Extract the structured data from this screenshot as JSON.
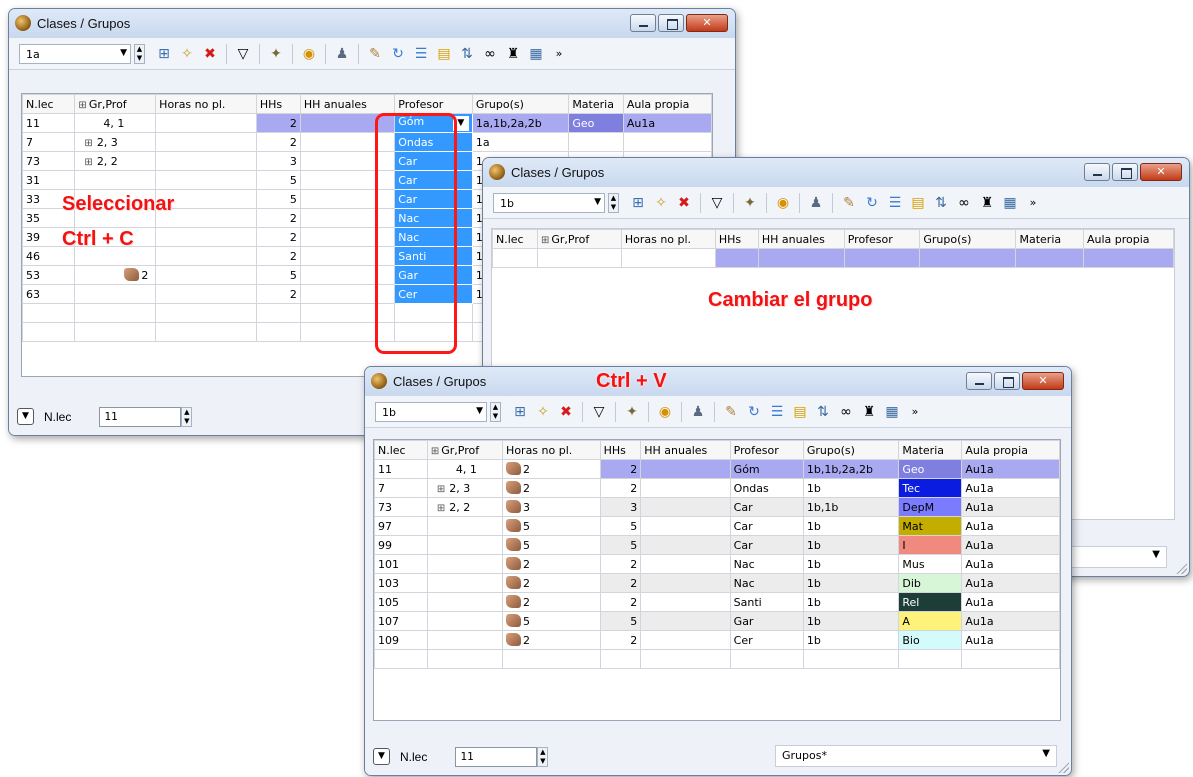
{
  "window1": {
    "title": "Clases / Grupos",
    "class_value": "1a",
    "columns": [
      "N.lec",
      "Gr,Prof",
      "Horas no pl.",
      "HHs",
      "HH anuales",
      "Profesor",
      "Grupo(s)",
      "Materia",
      "Aula propia"
    ],
    "rows": [
      {
        "nlec": "11",
        "gr": "4, 1",
        "gr_expand": false,
        "horas": "",
        "horas_icon": false,
        "hhs": "2",
        "prof": "Góm",
        "grupos": "1a,1b,2a,2b",
        "materia": "Geo",
        "aula": "Au1a"
      },
      {
        "nlec": "7",
        "gr": "2, 3",
        "gr_expand": true,
        "horas": "",
        "horas_icon": false,
        "hhs": "2",
        "prof": "Ondas",
        "grupos": "1a",
        "materia": "",
        "aula": ""
      },
      {
        "nlec": "73",
        "gr": "2, 2",
        "gr_expand": true,
        "horas": "",
        "horas_icon": false,
        "hhs": "3",
        "prof": "Car",
        "grupos": "1a,",
        "materia": "",
        "aula": ""
      },
      {
        "nlec": "31",
        "gr": "",
        "gr_expand": false,
        "horas": "",
        "horas_icon": false,
        "hhs": "5",
        "prof": "Car",
        "grupos": "1a",
        "materia": "",
        "aula": ""
      },
      {
        "nlec": "33",
        "gr": "",
        "gr_expand": false,
        "horas": "",
        "horas_icon": false,
        "hhs": "5",
        "prof": "Car",
        "grupos": "1a",
        "materia": "",
        "aula": ""
      },
      {
        "nlec": "35",
        "gr": "",
        "gr_expand": false,
        "horas": "",
        "horas_icon": false,
        "hhs": "2",
        "prof": "Nac",
        "grupos": "1a",
        "materia": "",
        "aula": ""
      },
      {
        "nlec": "39",
        "gr": "",
        "gr_expand": false,
        "horas": "",
        "horas_icon": false,
        "hhs": "2",
        "prof": "Nac",
        "grupos": "1a",
        "materia": "",
        "aula": ""
      },
      {
        "nlec": "46",
        "gr": "",
        "gr_expand": false,
        "horas": "",
        "horas_icon": false,
        "hhs": "2",
        "prof": "Santi",
        "grupos": "1a",
        "materia": "",
        "aula": ""
      },
      {
        "nlec": "53",
        "gr": "2",
        "gr_expand": false,
        "gr_icon": true,
        "horas": "",
        "horas_icon": false,
        "hhs": "5",
        "prof": "Gar",
        "grupos": "1a",
        "materia": "",
        "aula": ""
      },
      {
        "nlec": "63",
        "gr": "",
        "gr_expand": false,
        "horas": "",
        "horas_icon": false,
        "hhs": "2",
        "prof": "Cer",
        "grupos": "1a",
        "materia": "",
        "aula": ""
      }
    ],
    "footer_label": "N.lec",
    "footer_value": "11"
  },
  "window2": {
    "title": "Clases / Grupos",
    "class_value": "1b",
    "columns": [
      "N.lec",
      "Gr,Prof",
      "Horas no pl.",
      "HHs",
      "HH anuales",
      "Profesor",
      "Grupo(s)",
      "Materia",
      "Aula propia"
    ]
  },
  "window3": {
    "title": "Clases / Grupos",
    "class_value": "1b",
    "columns": [
      "N.lec",
      "Gr,Prof",
      "Horas no pl.",
      "HHs",
      "HH anuales",
      "Profesor",
      "Grupo(s)",
      "Materia",
      "Aula propia"
    ],
    "rows": [
      {
        "nlec": "11",
        "gr": "4, 1",
        "gr_expand": false,
        "horas": "2",
        "hhs": "2",
        "prof": "Góm",
        "grupos": "1b,1b,2a,2b",
        "materia": "Geo",
        "mat_bg": "#7f7fe0",
        "mat_fg": "#ffffff",
        "aula": "Au1a"
      },
      {
        "nlec": "7",
        "gr": "2, 3",
        "gr_expand": true,
        "horas": "2",
        "hhs": "2",
        "prof": "Ondas",
        "grupos": "1b",
        "materia": "Tec",
        "mat_bg": "#0a1ce0",
        "mat_fg": "#ffffff",
        "aula": "Au1a"
      },
      {
        "nlec": "73",
        "gr": "2, 2",
        "gr_expand": true,
        "horas": "3",
        "hhs": "3",
        "prof": "Car",
        "grupos": "1b,1b",
        "materia": "DepM",
        "mat_bg": "#7b7bff",
        "mat_fg": "#000000",
        "aula": "Au1a"
      },
      {
        "nlec": "97",
        "gr": "",
        "gr_expand": false,
        "horas": "5",
        "hhs": "5",
        "prof": "Car",
        "grupos": "1b",
        "materia": "Mat",
        "mat_bg": "#c3ae00",
        "mat_fg": "#000000",
        "aula": "Au1a"
      },
      {
        "nlec": "99",
        "gr": "",
        "gr_expand": false,
        "horas": "5",
        "hhs": "5",
        "prof": "Car",
        "grupos": "1b",
        "materia": "I",
        "mat_bg": "#f08a7e",
        "mat_fg": "#000000",
        "aula": "Au1a"
      },
      {
        "nlec": "101",
        "gr": "",
        "gr_expand": false,
        "horas": "2",
        "hhs": "2",
        "prof": "Nac",
        "grupos": "1b",
        "materia": "Mus",
        "mat_bg": "#ffffff",
        "mat_fg": "#000000",
        "aula": "Au1a"
      },
      {
        "nlec": "103",
        "gr": "",
        "gr_expand": false,
        "horas": "2",
        "hhs": "2",
        "prof": "Nac",
        "grupos": "1b",
        "materia": "Dib",
        "mat_bg": "#d7f5d7",
        "mat_fg": "#000000",
        "aula": "Au1a"
      },
      {
        "nlec": "105",
        "gr": "",
        "gr_expand": false,
        "horas": "2",
        "hhs": "2",
        "prof": "Santi",
        "grupos": "1b",
        "materia": "Rel",
        "mat_bg": "#1d3e36",
        "mat_fg": "#ffffff",
        "aula": "Au1a"
      },
      {
        "nlec": "107",
        "gr": "",
        "gr_expand": false,
        "horas": "5",
        "hhs": "5",
        "prof": "Gar",
        "grupos": "1b",
        "materia": "A",
        "mat_bg": "#fff27a",
        "mat_fg": "#000000",
        "aula": "Au1a"
      },
      {
        "nlec": "109",
        "gr": "",
        "gr_expand": false,
        "horas": "2",
        "hhs": "2",
        "prof": "Cer",
        "grupos": "1b",
        "materia": "Bio",
        "mat_bg": "#d4fbfb",
        "mat_fg": "#000000",
        "aula": "Au1a"
      }
    ],
    "footer_label": "N.lec",
    "footer_value": "11",
    "footer_select": "Grupos*"
  },
  "annotations": {
    "select": "Seleccionar",
    "copy": "Ctrl + C",
    "change": "Cambiar el grupo",
    "paste": "Ctrl + V"
  },
  "colors": {
    "selection_row": "#a9a9f2",
    "selected_cell": "#3399ff",
    "annotation_red": "#f31212"
  }
}
